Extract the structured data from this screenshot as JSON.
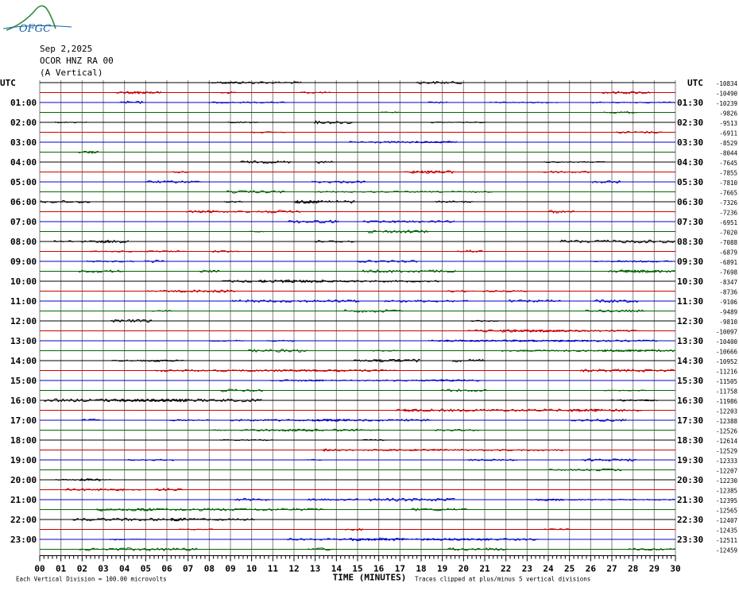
{
  "logo": {
    "text": "OFGC"
  },
  "header": {
    "date": "Sep 2,2025",
    "station": "OCOR HNZ RA 00",
    "component": "(A Vertical)"
  },
  "utc_label_left": "UTC",
  "utc_label_right": "UTC",
  "left_times": [
    "01:00",
    "02:00",
    "03:00",
    "04:00",
    "05:00",
    "06:00",
    "07:00",
    "08:00",
    "09:00",
    "10:00",
    "11:00",
    "12:00",
    "13:00",
    "14:00",
    "15:00",
    "16:00",
    "17:00",
    "18:00",
    "19:00",
    "20:00",
    "21:00",
    "22:00",
    "23:00"
  ],
  "right_times": [
    "01:30",
    "02:30",
    "03:30",
    "04:30",
    "05:30",
    "06:30",
    "07:30",
    "08:30",
    "09:30",
    "10:30",
    "11:30",
    "12:30",
    "13:30",
    "14:30",
    "15:30",
    "16:30",
    "17:30",
    "18:30",
    "19:30",
    "20:30",
    "21:30",
    "22:30",
    "23:30"
  ],
  "right_values": [
    "-10834",
    "-10490",
    "-10239",
    "-9826",
    "-9513",
    "-6911",
    "-8529",
    "-8044",
    "-7645",
    "-7855",
    "-7810",
    "-7665",
    "-7326",
    "-7236",
    "-6951",
    "-7020",
    "-7088",
    "-6879",
    "-6891",
    "-7698",
    "-8347",
    "-8736",
    "-9106",
    "-9489",
    "-9810",
    "-10097",
    "-10400",
    "-10666",
    "-10952",
    "-11216",
    "-11505",
    "-11758",
    "-11986",
    "-12203",
    "-12388",
    "-12526",
    "-12614",
    "-12529",
    "-12333",
    "-12207",
    "-12230",
    "-12385",
    "-12395",
    "-12565",
    "-12407",
    "-12435",
    "-12511",
    "-12459"
  ],
  "x_ticks": [
    "00",
    "01",
    "02",
    "03",
    "04",
    "05",
    "06",
    "07",
    "08",
    "09",
    "10",
    "11",
    "12",
    "13",
    "14",
    "15",
    "16",
    "17",
    "18",
    "19",
    "20",
    "21",
    "22",
    "23",
    "24",
    "25",
    "26",
    "27",
    "28",
    "29",
    "30"
  ],
  "x_axis_title": "TIME (MINUTES)",
  "footer_left": "Each Vertical Division =  100.00 microvolts",
  "footer_right": "Traces clipped at plus/minus 5 vertical divisions",
  "colors": {
    "trace_cycle": [
      "#000000",
      "#cc0000",
      "#0000cc",
      "#006600"
    ],
    "grid": "#808080",
    "text": "#000000",
    "logo": "#1a5fa8",
    "logo_hill": "#2e8b3a"
  }
}
